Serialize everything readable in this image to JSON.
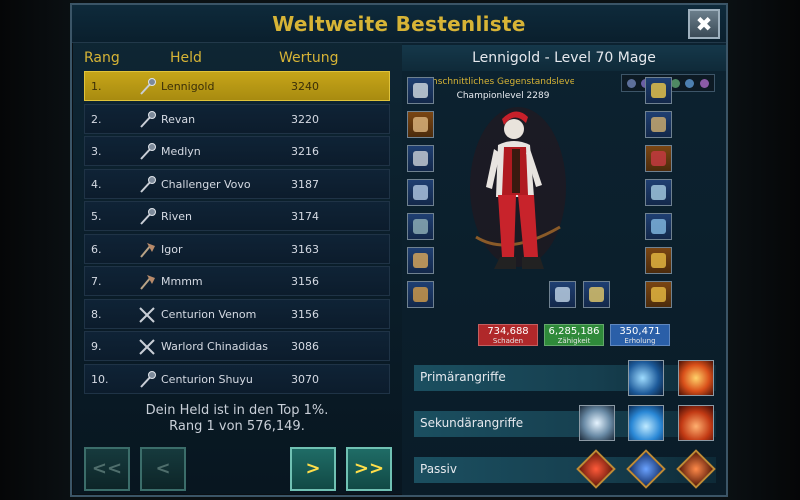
{
  "title": "Weltweite Bestenliste",
  "close_label": "✖",
  "columns": {
    "rank": "Rang",
    "hero": "Held",
    "score": "Wertung"
  },
  "leaderboard": [
    {
      "rank": "1.",
      "name": "Lennigold",
      "score": "3240",
      "class_icon": "staff-icon",
      "selected": true
    },
    {
      "rank": "2.",
      "name": "Revan",
      "score": "3220",
      "class_icon": "staff-icon"
    },
    {
      "rank": "3.",
      "name": "Medlyn",
      "score": "3216",
      "class_icon": "staff-icon"
    },
    {
      "rank": "4.",
      "name": "Challenger Vovo",
      "score": "3187",
      "class_icon": "staff-icon"
    },
    {
      "rank": "5.",
      "name": "Riven",
      "score": "3174",
      "class_icon": "staff-icon"
    },
    {
      "rank": "6.",
      "name": "Igor",
      "score": "3163",
      "class_icon": "axe-icon"
    },
    {
      "rank": "7.",
      "name": "Mmmm",
      "score": "3156",
      "class_icon": "axe-icon"
    },
    {
      "rank": "8.",
      "name": "Centurion Venom",
      "score": "3156",
      "class_icon": "crossed-swords-icon"
    },
    {
      "rank": "9.",
      "name": "Warlord Chinadidas",
      "score": "3086",
      "class_icon": "crossed-swords-icon"
    },
    {
      "rank": "10.",
      "name": "Centurion Shuyu",
      "score": "3070",
      "class_icon": "staff-icon"
    }
  ],
  "summary": {
    "line1": "Dein Held ist in den Top 1%.",
    "line2": "Rang 1 von 576,149."
  },
  "nav": {
    "first": "<<",
    "prev": "<",
    "next": ">",
    "last": ">>"
  },
  "hero": {
    "header": "Lennigold - Level 70 Mage",
    "item_level_label": "hschnittliches Gegenstandslevel:",
    "champion_level": "Championlevel 2289",
    "stats": [
      {
        "value": "734,688",
        "label": "Schaden",
        "color": "#b0282a"
      },
      {
        "value": "6,285,186",
        "label": "Zähigkeit",
        "color": "#2f8a3a"
      },
      {
        "value": "350,471",
        "label": "Erholung",
        "color": "#2a5fa8"
      }
    ]
  },
  "abilities": {
    "primary_label": "Primärangriffe",
    "secondary_label": "Sekundärangriffe",
    "passive_label": "Passiv"
  },
  "colors": {
    "accent": "#d7b436",
    "selected_row": "#c6a519"
  }
}
